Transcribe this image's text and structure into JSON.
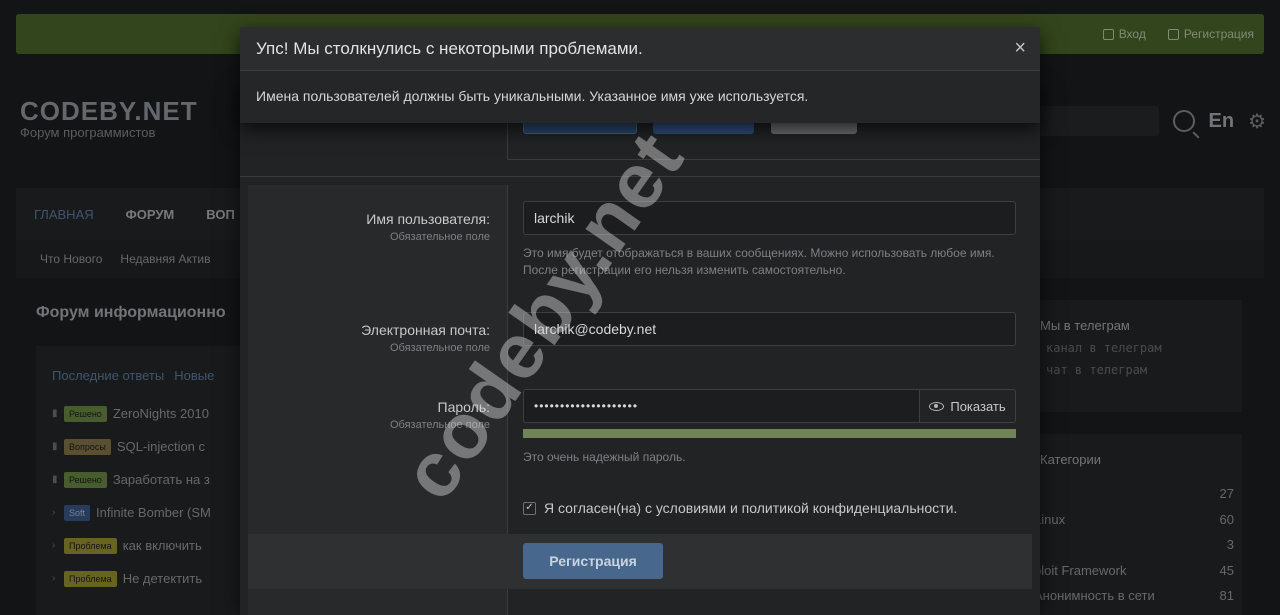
{
  "topbar": {
    "login": "Вход",
    "register": "Регистрация"
  },
  "logo": {
    "name": "CODEBY.NET",
    "subtitle": "Форум программистов"
  },
  "header": {
    "lang": "En"
  },
  "nav": {
    "items": [
      "ГЛАВНАЯ",
      "ФОРУМ",
      "ВОП"
    ]
  },
  "subnav": {
    "items": [
      "Что Нового",
      "Недавняя Актив"
    ]
  },
  "section_title": "Форум информационно",
  "feed": {
    "tabs": [
      "Последние ответы",
      "Новые"
    ],
    "rows": [
      {
        "badge": "Решено",
        "title": "ZeroNights 2010"
      },
      {
        "badge": "Вопросы",
        "title": "SQL-injection c"
      },
      {
        "badge": "Решено",
        "title": "Заработать на з"
      },
      {
        "badge": "Soft",
        "title": "Infinite Bomber (SM"
      },
      {
        "badge": "Проблема",
        "title": "как включить"
      },
      {
        "badge": "Проблема",
        "title": "Не детектить"
      }
    ]
  },
  "sidebar1": {
    "title": "Мы в телеграм",
    "links": [
      "канал в телеграм",
      "чат в телеграм"
    ]
  },
  "sidebar2": {
    "title": "Категории",
    "rows": [
      {
        "label": "",
        "count": "27"
      },
      {
        "label": "Linux",
        "count": "60"
      },
      {
        "label": "",
        "count": "3"
      },
      {
        "label": "ploit Framework",
        "count": "45"
      },
      {
        "label": "Анонимность в сети",
        "count": "81"
      }
    ]
  },
  "form": {
    "username_label": "Имя пользователя:",
    "username_hint": "Обязательное поле",
    "username_value": "larchik",
    "username_desc": "Это имя будет отображаться в ваших сообщениях. Можно использовать любое имя. После регистрации его нельзя изменить самостоятельно.",
    "email_label": "Электронная почта:",
    "email_hint": "Обязательное поле",
    "email_value": "larchik@codeby.net",
    "password_label": "Пароль:",
    "password_hint": "Обязательное поле",
    "password_value": "••••••••••••••••••••",
    "show_label": "Показать",
    "strength_percent": 100,
    "strength_text": "Это очень надежный пароль.",
    "agree_text": "Я согласен(на) с условиями и политикой конфиденциальности.",
    "agree_checked": true,
    "submit_label": "Регистрация"
  },
  "error": {
    "title": "Упс! Мы столкнулись с некоторыми проблемами.",
    "message": "Имена пользователей должны быть уникальными. Указанное имя уже используется.",
    "close": "×"
  },
  "watermark": "codeby.net"
}
